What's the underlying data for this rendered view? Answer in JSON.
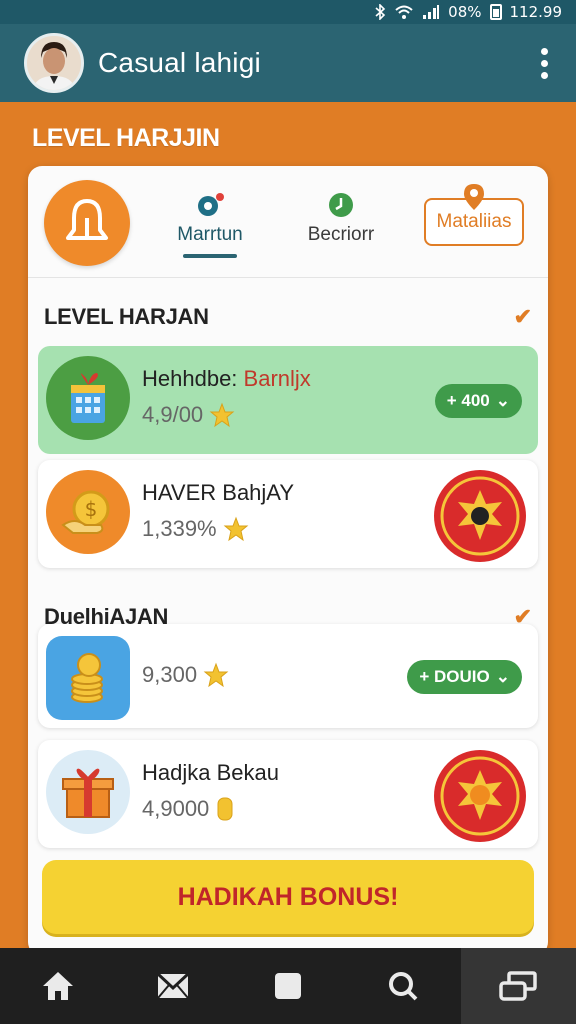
{
  "status_bar": {
    "battery": "08%",
    "time": "112.99"
  },
  "app_bar": {
    "title": "Casual lahigi",
    "avatar": "avatar",
    "menu_icon": "more-vertical-icon"
  },
  "page": {
    "heading": "LEVEL HARJJIN"
  },
  "tabs": [
    {
      "label": "Marrtun",
      "icon": "dot-icon",
      "active": true
    },
    {
      "label": "Becriorr",
      "icon": "clock-icon",
      "active": false
    },
    {
      "label": "Mataliias",
      "icon": "pin-icon",
      "active": false
    }
  ],
  "sections": [
    {
      "title": "LEVEL HARJAN",
      "items": [
        {
          "title": "Hehhdbe:",
          "title_accent": "Barnljx",
          "value": "4,9/00",
          "action": "+ 400",
          "icon": "building-gift-icon"
        },
        {
          "title": "HAVER BahjAY",
          "value": "1,339%",
          "badge": "badge-seal-icon",
          "icon": "coin-hand-icon"
        }
      ]
    },
    {
      "title": "DuelhiAJAN",
      "items": [
        {
          "title": "",
          "value": "9,300",
          "action": "+ DOUIO",
          "icon": "coin-stack-icon"
        },
        {
          "title": "Hadjka Bekau",
          "value": "4,9000",
          "badge": "badge-sun-icon",
          "icon": "gift-box-icon"
        }
      ]
    }
  ],
  "bonus_button": "HADIKAH BONUS!",
  "bottom_nav": [
    "home-icon",
    "mail-icon",
    "square-icon",
    "search-icon",
    "window-icon"
  ],
  "colors": {
    "primary": "#2b6472",
    "accent": "#e07d25",
    "green": "#3f9b4a",
    "bonus": "#f5d232",
    "bonus_text": "#c0262a"
  }
}
